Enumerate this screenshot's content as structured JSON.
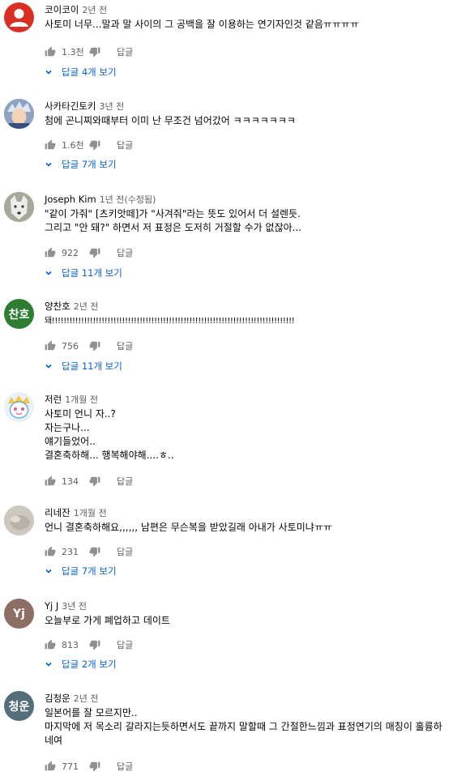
{
  "comments": [
    {
      "author": "코이코이",
      "time": "2년 전",
      "text": "사토미 너무...말과 말 사이의 그 공백을 잘 이용하는 연기자인것 같음ㅠㅠㅠㅠ",
      "likes": "1.3천",
      "reply_label": "답글",
      "view_replies": "답글 4개 보기",
      "avatar_color": "#d93025",
      "avatar_initials": ""
    },
    {
      "author": "사카타긴토키",
      "time": "3년 전",
      "text": "첨에 곤니찌와때부터 이미 난 무조건 넘어갔어 ㅋㅋㅋㅋㅋㅋㅋ",
      "likes": "1.6천",
      "reply_label": "답글",
      "view_replies": "답글 7개 보기",
      "avatar_color": "#7d8fb3",
      "avatar_initials": ""
    },
    {
      "author": "Joseph Kim",
      "time": "1년 전(수정됨)",
      "text": "\"같이 가줘\" [츠키앗떼]가 \"사겨줘\"라는 뜻도 있어서 더 설렌듯.\n그리고 \"안 돼?\" 하면서 저 표정은 도저히 거절할 수가 없잖아...",
      "likes": "922",
      "reply_label": "답글",
      "view_replies": "답글 11개 보기",
      "avatar_color": "#9a9a8f",
      "avatar_initials": ""
    },
    {
      "author": "양찬호",
      "time": "2년 전",
      "text": "돼!!!!!!!!!!!!!!!!!!!!!!!!!!!!!!!!!!!!!!!!!!!!!!!!!!!!!!!!!!!!!!!!!!!!!!!!!!!!!!!!!!!",
      "likes": "756",
      "reply_label": "답글",
      "view_replies": "답글 11개 보기",
      "avatar_color": "#2e7d32",
      "avatar_initials": "찬호"
    },
    {
      "author": "저런",
      "time": "1개월 전",
      "text": "사토미 언니 자..?\n자는구나...\n얘기들었어..\n결혼축하해... 행복해야해....ㅎ..",
      "likes": "134",
      "reply_label": "답글",
      "view_replies": "",
      "avatar_color": "#e3eef7",
      "avatar_initials": ""
    },
    {
      "author": "리네잔",
      "time": "1개월 전",
      "text": "언니 결혼축하해요,,,,,, 남편은 무슨복을 받았길래 아내가 사토미냐ㅠㅠ",
      "likes": "231",
      "reply_label": "답글",
      "view_replies": "답글 7개 보기",
      "avatar_color": "#c7c2b8",
      "avatar_initials": ""
    },
    {
      "author": "Yj J",
      "time": "3년 전",
      "text": "오늘부로 가게 폐업하고 데이트",
      "likes": "813",
      "reply_label": "답글",
      "view_replies": "답글 2개 보기",
      "avatar_color": "#8d6e63",
      "avatar_initials": "Yj"
    },
    {
      "author": "김청운",
      "time": "2년 전",
      "text": "일본어를 잘 모르지만..\n마지막에 저 목소리 갈라지는듯하면서도 끝까지 말할때 그 간절한느낌과 표정연기의 매칭이 훌륭하네여",
      "likes": "771",
      "reply_label": "답글",
      "view_replies": "",
      "avatar_color": "#546e7a",
      "avatar_initials": "청운"
    }
  ]
}
